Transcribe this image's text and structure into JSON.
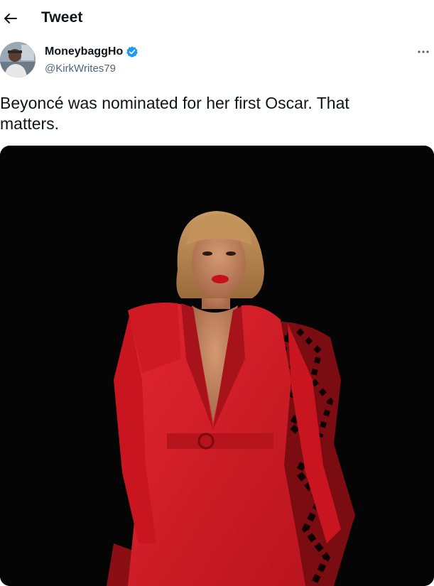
{
  "header": {
    "back_icon": "arrow-left-icon",
    "title": "Tweet"
  },
  "author": {
    "display_name": "MoneybaggHo",
    "handle": "@KirkWrites79",
    "verified": true,
    "verified_color": "#1d9bf0",
    "more_icon": "more-horizontal-icon"
  },
  "tweet": {
    "text": "Beyoncé was nominated for her first Oscar. That\nmatters."
  },
  "media": {
    "type": "photo",
    "background": "#050505",
    "accent": "#d4202a"
  }
}
